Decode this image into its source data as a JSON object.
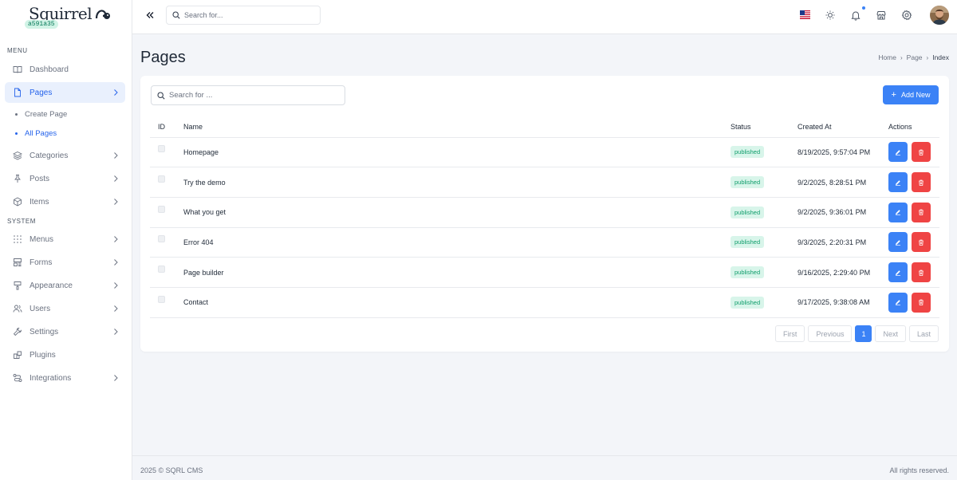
{
  "app": {
    "logo_text": "Squirrel",
    "version": "a591a35"
  },
  "sidebar": {
    "menu_label": "MENU",
    "system_label": "SYSTEM",
    "items": [
      {
        "label": "Dashboard",
        "icon": "book-icon"
      },
      {
        "label": "Pages",
        "icon": "file-icon"
      },
      {
        "label": "Categories",
        "icon": "layers-icon"
      },
      {
        "label": "Posts",
        "icon": "pin-icon"
      },
      {
        "label": "Items",
        "icon": "cube-icon"
      }
    ],
    "pages_sub": [
      {
        "label": "Create Page"
      },
      {
        "label": "All Pages"
      }
    ],
    "system_items": [
      {
        "label": "Menus",
        "icon": "grid-icon"
      },
      {
        "label": "Forms",
        "icon": "form-icon"
      },
      {
        "label": "Appearance",
        "icon": "paint-icon"
      },
      {
        "label": "Users",
        "icon": "users-icon"
      },
      {
        "label": "Settings",
        "icon": "wrench-icon"
      },
      {
        "label": "Plugins",
        "icon": "plug-icon"
      },
      {
        "label": "Integrations",
        "icon": "route-icon"
      }
    ]
  },
  "topbar": {
    "search_placeholder": "Search for..."
  },
  "page": {
    "title": "Pages",
    "breadcrumb": [
      "Home",
      "Page",
      "Index"
    ]
  },
  "table": {
    "search_placeholder": "Search for ...",
    "add_label": "Add New",
    "headers": {
      "id": "ID",
      "name": "Name",
      "status": "Status",
      "created": "Created At",
      "actions": "Actions"
    },
    "rows": [
      {
        "name": "Homepage",
        "status": "published",
        "created": "8/19/2025, 9:57:04 PM"
      },
      {
        "name": "Try the demo",
        "status": "published",
        "created": "9/2/2025, 8:28:51 PM"
      },
      {
        "name": "What you get",
        "status": "published",
        "created": "9/2/2025, 9:36:01 PM"
      },
      {
        "name": "Error 404",
        "status": "published",
        "created": "9/3/2025, 2:20:31 PM"
      },
      {
        "name": "Page builder",
        "status": "published",
        "created": "9/16/2025, 2:29:40 PM"
      },
      {
        "name": "Contact",
        "status": "published",
        "created": "9/17/2025, 9:38:08 AM"
      }
    ]
  },
  "pagination": {
    "first": "First",
    "previous": "Previous",
    "current": "1",
    "next": "Next",
    "last": "Last"
  },
  "footer": {
    "copyright": "2025 © SQRL CMS",
    "rights": "All rights reserved."
  },
  "colors": {
    "accent": "#3b82f6",
    "danger": "#ef4444",
    "success_bg": "#d8f5ea",
    "success_text": "#0f9d6b"
  }
}
